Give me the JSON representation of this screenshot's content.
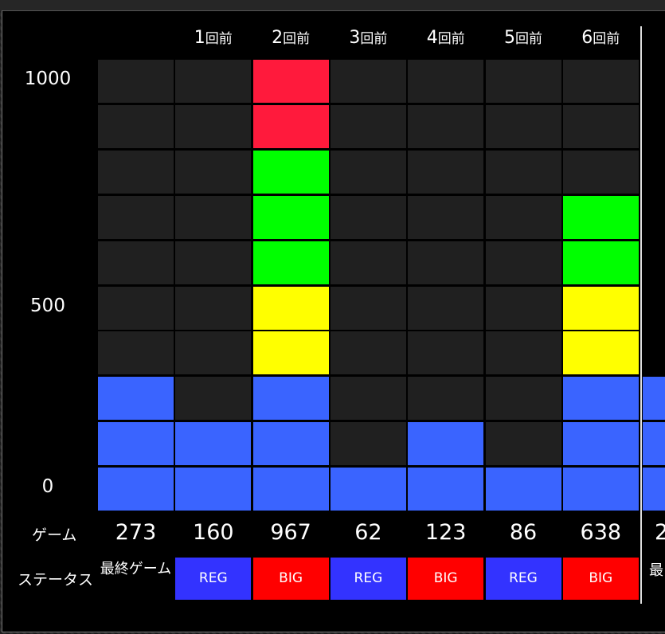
{
  "chart_data": {
    "type": "bar",
    "categories": [
      "1回前",
      "2回前",
      "3回前",
      "4回前",
      "5回前",
      "6回前"
    ],
    "first_column_value": "273",
    "y_ticks": [
      "1000",
      "500",
      "0"
    ],
    "ylim": [
      0,
      1000
    ],
    "values": [
      160,
      967,
      62,
      123,
      86,
      638
    ],
    "row_labels": {
      "game": "ゲーム",
      "status": "ステータス"
    },
    "games": [
      "273",
      "160",
      "967",
      "62",
      "123",
      "86",
      "638"
    ],
    "statuses": [
      "最終ゲーム",
      "REG",
      "BIG",
      "REG",
      "BIG",
      "REG",
      "BIG"
    ],
    "partial_next": {
      "game": "2",
      "status": "最"
    },
    "colors": {
      "empty": "#202020",
      "blue": "#3a64ff",
      "yellow": "#ffff00",
      "green": "#00ff00",
      "red": "#ff1a3c",
      "status_reg": "#3333ff",
      "status_big": "#ff0000"
    }
  }
}
